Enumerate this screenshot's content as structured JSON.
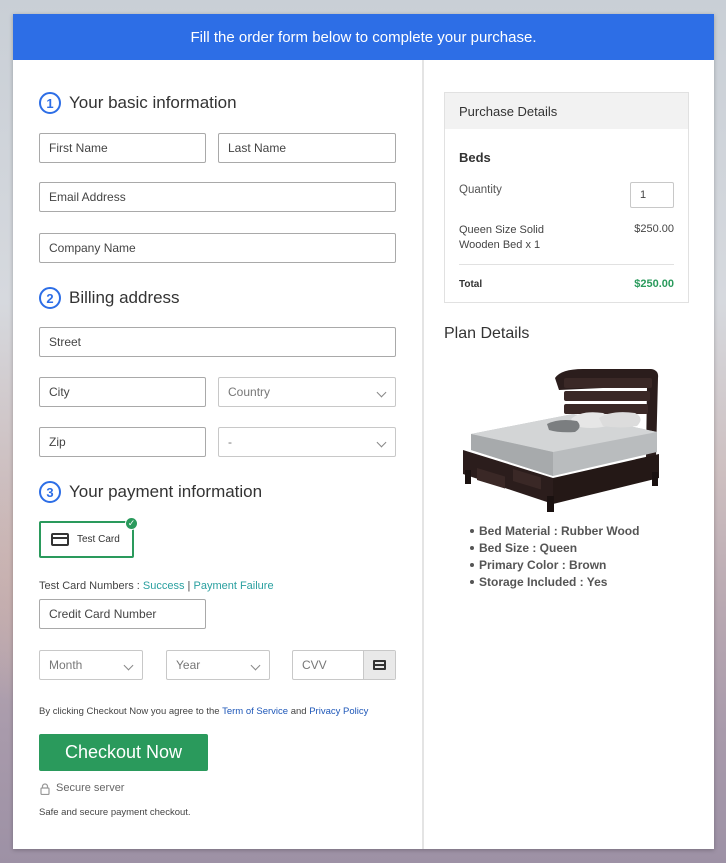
{
  "banner": {
    "text": "Fill the order form below to complete your purchase."
  },
  "basic_info": {
    "step": "1",
    "title": "Your basic information",
    "first_name_placeholder": "First Name",
    "last_name_placeholder": "Last Name",
    "email_placeholder": "Email Address",
    "company_placeholder": "Company Name"
  },
  "billing": {
    "step": "2",
    "title": "Billing address",
    "street_placeholder": "Street",
    "city_placeholder": "City",
    "country_value": "Country",
    "zip_placeholder": "Zip",
    "state_value": "-"
  },
  "payment": {
    "step": "3",
    "title": "Your payment information",
    "test_card_label": "Test Card",
    "test_numbers_label": "Test Card Numbers : ",
    "success_link": "Success",
    "separator": " | ",
    "failure_link": "Payment Failure",
    "card_number_placeholder": "Credit Card Number",
    "month_value": "Month",
    "year_value": "Year",
    "cvv_placeholder": "CVV"
  },
  "agreement": {
    "prefix": "By clicking Checkout Now you agree to the ",
    "tos_link": "Term of Service",
    "and": " and ",
    "privacy_link": "Privacy Policy"
  },
  "checkout": {
    "button_label": "Checkout Now",
    "secure_label": "Secure server",
    "safe_text": "Safe and secure payment checkout."
  },
  "purchase": {
    "header": "Purchase Details",
    "product_group": "Beds",
    "quantity_label": "Quantity",
    "quantity_value": "1",
    "item_name_line1": "Queen Size Solid",
    "item_name_line2": "Wooden Bed x 1",
    "item_price": "$250.00",
    "total_label": "Total",
    "total_value": "$250.00"
  },
  "plan": {
    "title": "Plan Details",
    "features": [
      "Bed Material : Rubber Wood",
      "Bed Size : Queen",
      "Primary Color : Brown",
      "Storage Included : Yes"
    ]
  },
  "colors": {
    "banner_blue": "#2d6ee6",
    "checkout_green": "#2a9a5c",
    "total_green": "#2a9a5c"
  },
  "icons": [
    "credit-card-icon",
    "check-icon",
    "chevron-down-icon",
    "lock-icon",
    "cvv-card-icon"
  ]
}
